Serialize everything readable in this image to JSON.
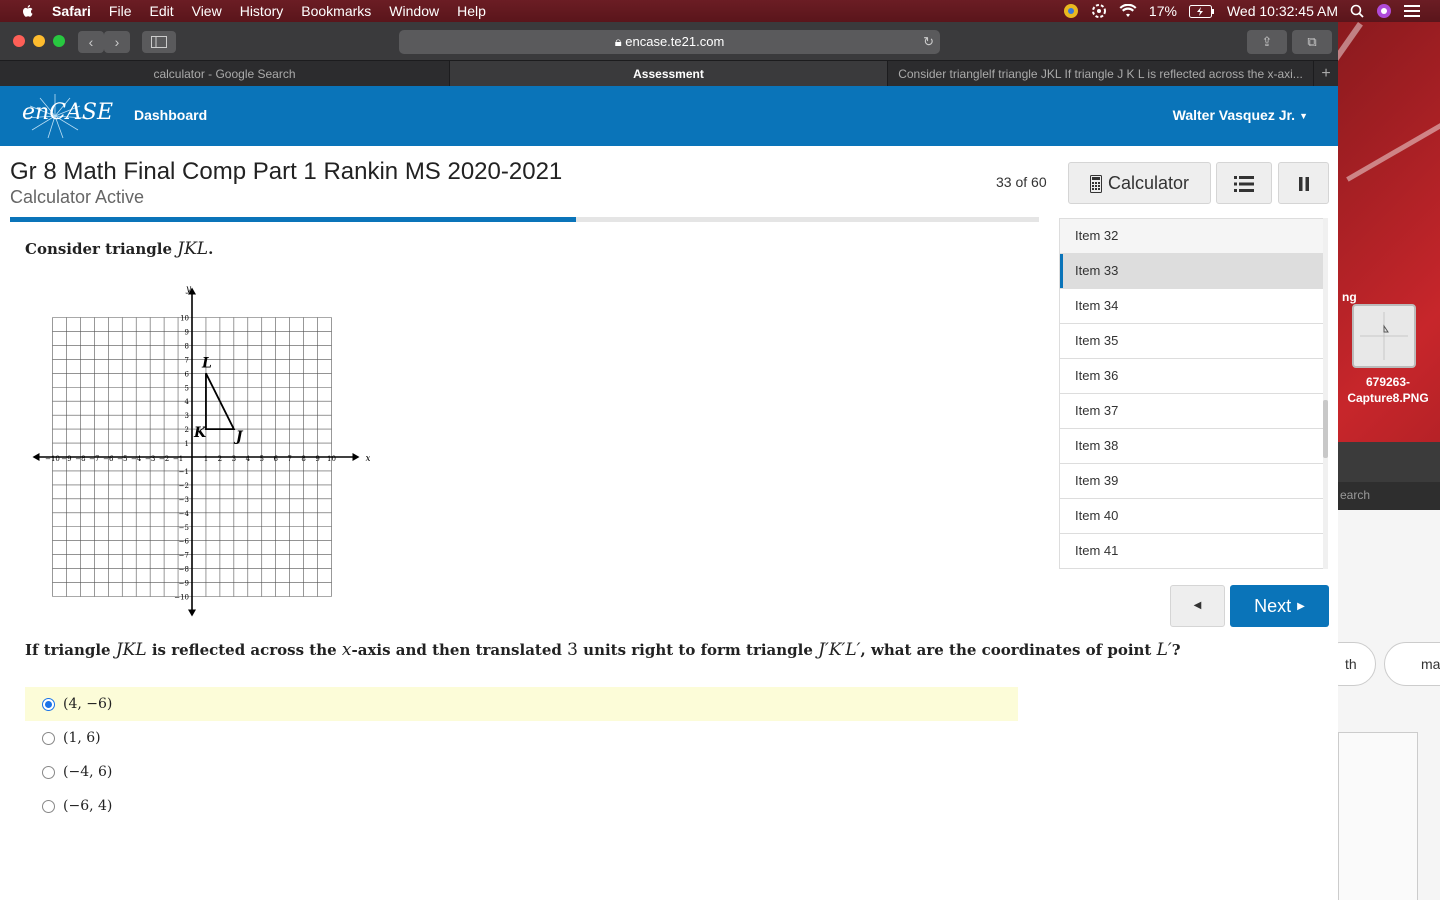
{
  "menubar": {
    "app": "Safari",
    "items": [
      "File",
      "Edit",
      "View",
      "History",
      "Bookmarks",
      "Window",
      "Help"
    ],
    "battery": "17%",
    "datetime": "Wed 10:32:45 AM"
  },
  "browser": {
    "url": "encase.te21.com",
    "tabs": [
      {
        "label": "calculator - Google Search"
      },
      {
        "label": "Assessment"
      },
      {
        "label": "Consider trianglelf triangle JKL If triangle J K L is reflected across the x-axi..."
      }
    ]
  },
  "app": {
    "logo": "enCASE",
    "nav_dashboard": "Dashboard",
    "user": "Walter Vasquez Jr."
  },
  "assessment": {
    "title": "Gr 8 Math Final Comp Part 1 Rankin MS 2020-2021",
    "subtitle": "Calculator Active",
    "counter": "33 of 60",
    "calculator_label": "Calculator",
    "progress": 0.55
  },
  "question": {
    "prompt_pre": "Consider triangle ",
    "prompt_math": "JKL",
    "prompt_post": ".",
    "q_part1": "If triangle ",
    "q_math1": "JKL",
    "q_part2": " is reflected across the ",
    "q_math2": "x",
    "q_part3": "-axis and then translated ",
    "q_math3": "3",
    "q_part4": " units right to form triangle ",
    "q_math4": "J′K′L′",
    "q_part5": ", what are the coordinates of point ",
    "q_math5": "L′",
    "q_part6": "?",
    "choices": [
      {
        "label": "(4, −6)",
        "selected": true
      },
      {
        "label": "(1, 6)",
        "selected": false
      },
      {
        "label": "(−4, 6)",
        "selected": false
      },
      {
        "label": "(−6, 4)",
        "selected": false
      }
    ]
  },
  "graph": {
    "axis_x": "x",
    "axis_y": "y",
    "range": [
      -10,
      10
    ],
    "points": [
      {
        "name": "K",
        "x": 1,
        "y": 2
      },
      {
        "name": "J",
        "x": 3,
        "y": 2
      },
      {
        "name": "L",
        "x": 1,
        "y": 6
      }
    ]
  },
  "items": [
    "Item 32",
    "Item 33",
    "Item 34",
    "Item 35",
    "Item 36",
    "Item 37",
    "Item 38",
    "Item 39",
    "Item 40",
    "Item 41"
  ],
  "nav": {
    "prev_glyph": "◀",
    "next_label": "Next",
    "next_glyph": "▶"
  },
  "desktop": {
    "label_ng": "ng",
    "thumb_label_1": "679263-",
    "thumb_label_2": "Capture8.PNG",
    "search_fragment": "earch",
    "pill_a": "th",
    "pill_b": "maxin"
  }
}
